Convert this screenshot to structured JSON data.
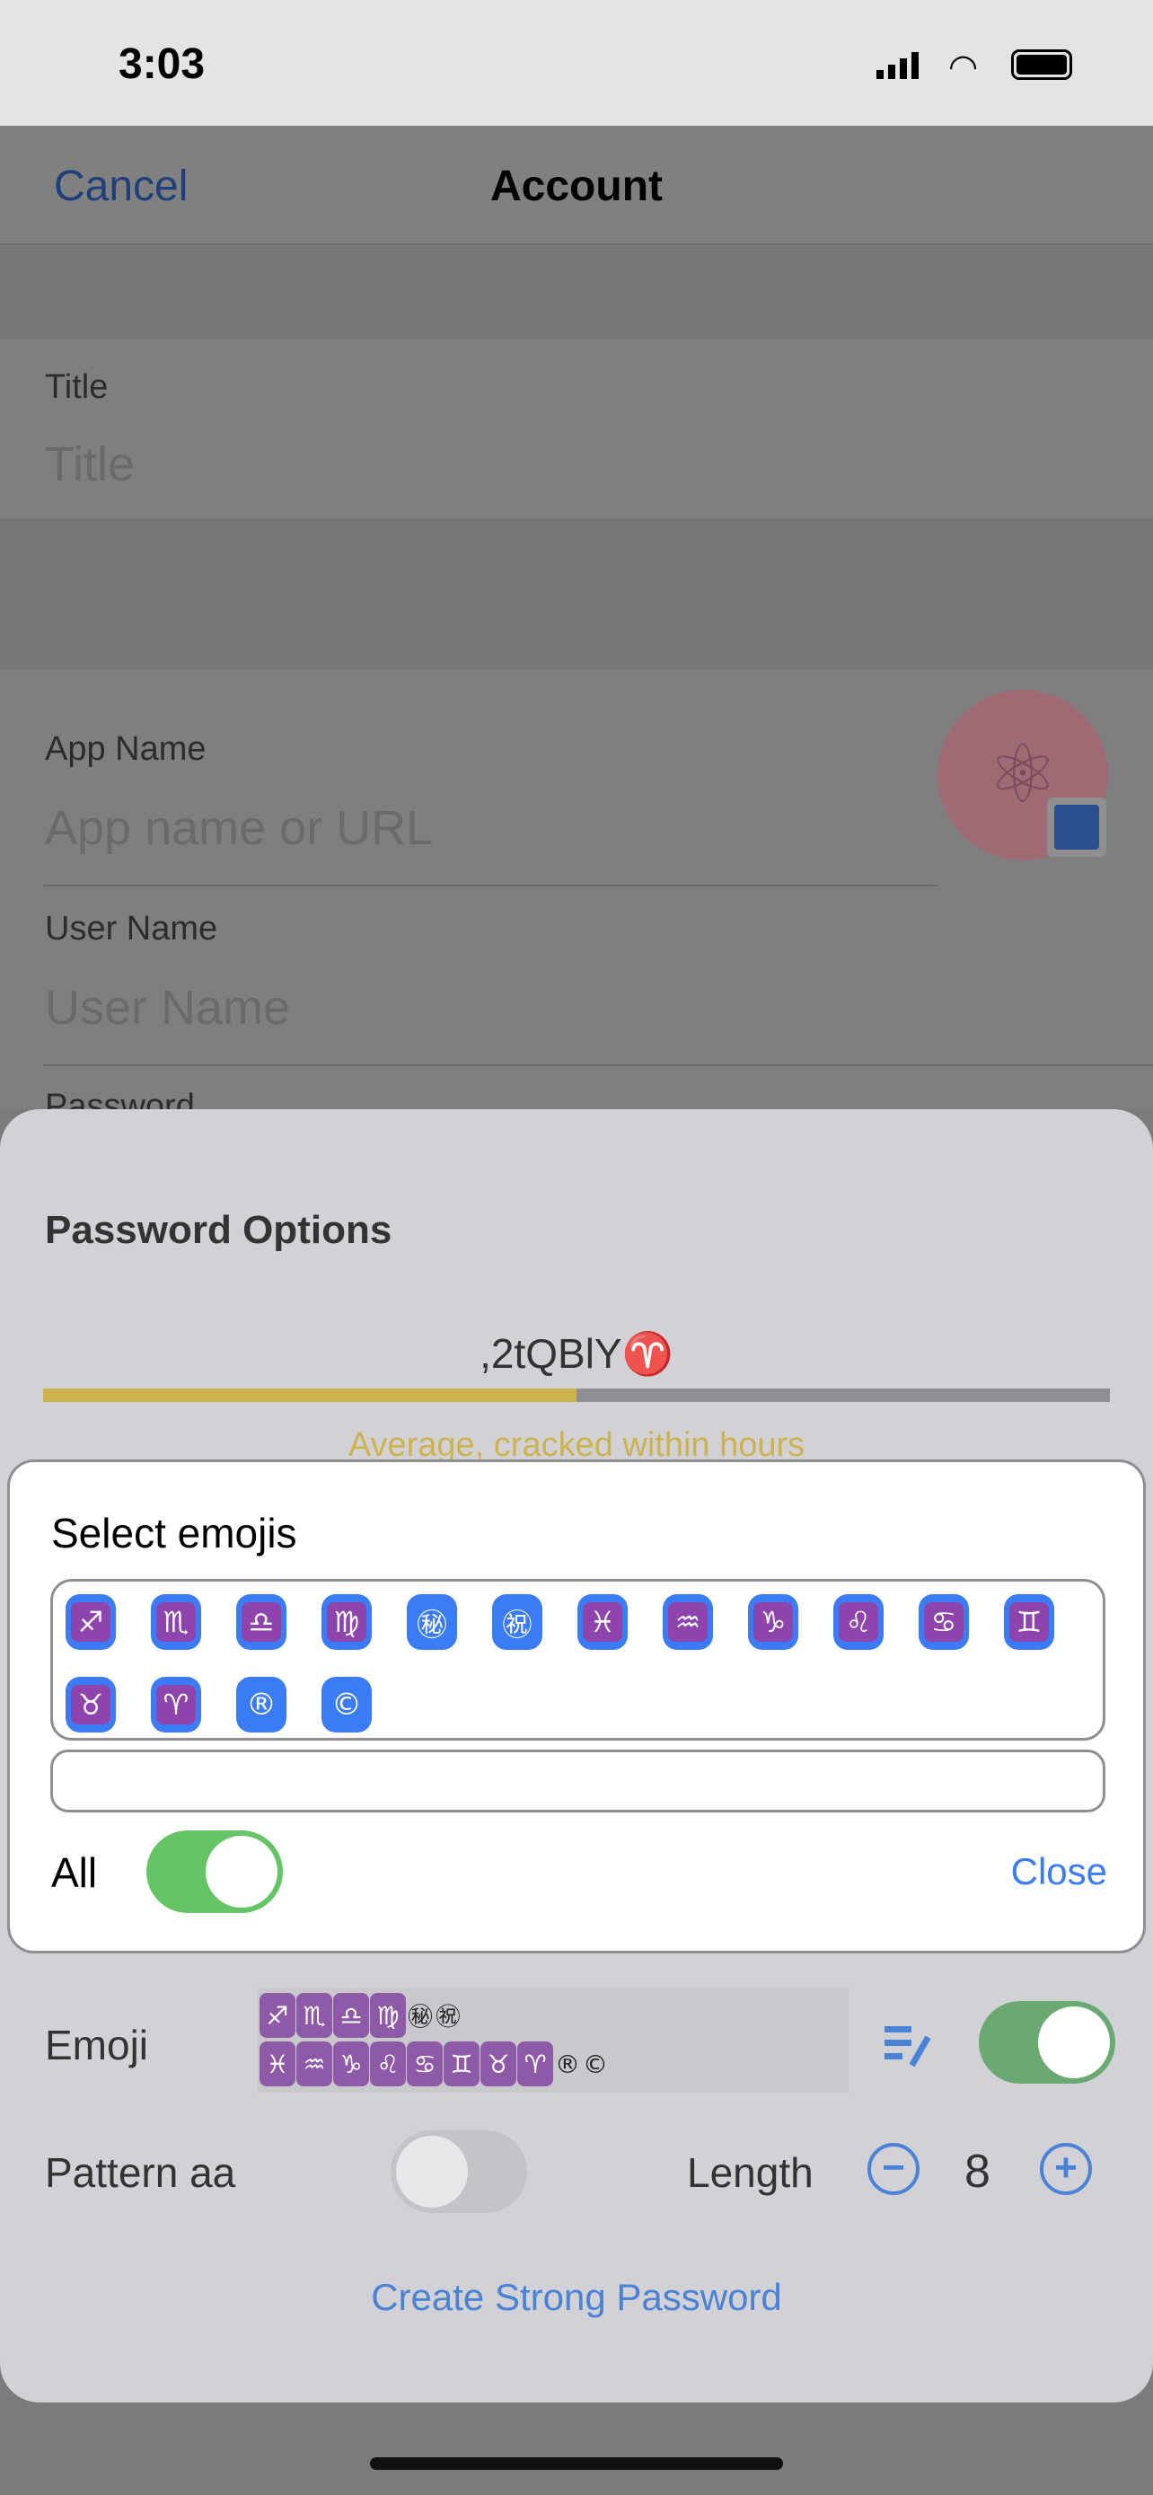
{
  "status_bar": {
    "time": "3:03"
  },
  "nav": {
    "cancel": "Cancel",
    "title": "Account"
  },
  "form": {
    "title_label": "Title",
    "title_placeholder": "Title",
    "app_name_label": "App Name",
    "app_name_placeholder": "App name or URL",
    "user_name_label": "User Name",
    "user_name_placeholder": "User Name",
    "password_label": "Password",
    "avatar_icon": "atom-icon",
    "avatar_edit_icon": "image-edit-icon"
  },
  "sheet": {
    "title": "Password Options",
    "password": ",2tQBlY♈",
    "strength_fraction": 0.5,
    "strength_text": "Average, cracked within hours",
    "colors": {
      "strength_fill": "#cdb34f",
      "strength_track": "#8e8e93",
      "accent": "#4a82d6",
      "toggle_on": "#65c466"
    },
    "emoji_label": "Emoji",
    "emoji_line1": [
      "♐",
      "♏",
      "♎",
      "♍",
      "㊙",
      "㊗"
    ],
    "emoji_line2": [
      "♓",
      "♒",
      "♑",
      "♌",
      "♋",
      "♊",
      "♉",
      "♈",
      "®",
      "©"
    ],
    "emoji_enabled": true,
    "pattern_label": "Pattern aa",
    "pattern_enabled": false,
    "length_label": "Length",
    "length_value": "8",
    "create_label": "Create Strong Password"
  },
  "dialog": {
    "title": "Select emojis",
    "emojis": [
      "♐",
      "♏",
      "♎",
      "♍",
      "㊙",
      "㊗",
      "♓",
      "♒",
      "♑",
      "♌",
      "♋",
      "♊",
      "♉",
      "♈",
      "®",
      "©"
    ],
    "input_value": "",
    "all_label": "All",
    "all_enabled": true,
    "close_label": "Close"
  }
}
